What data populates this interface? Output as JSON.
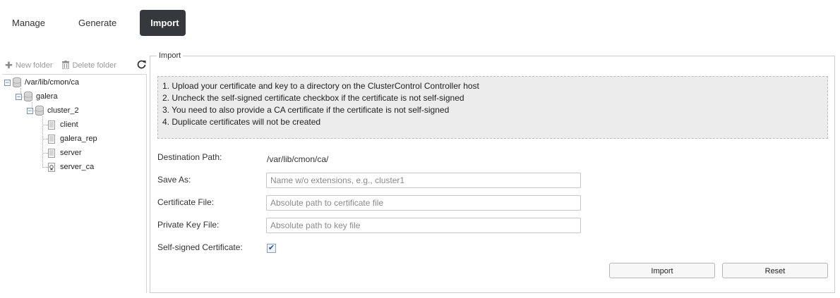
{
  "tabs": [
    {
      "label": "Manage",
      "active": false
    },
    {
      "label": "Generate",
      "active": false
    },
    {
      "label": "Import",
      "active": true
    }
  ],
  "toolbar": {
    "new_folder": "New folder",
    "delete_folder": "Delete folder",
    "refresh_icon": "refresh-icon"
  },
  "tree": {
    "root": "/var/lib/cmon/ca",
    "galera": "galera",
    "cluster": "cluster_2",
    "files": [
      "client",
      "galera_rep",
      "server",
      "server_ca"
    ]
  },
  "import_section": {
    "legend": "Import",
    "instructions": [
      "1. Upload your certificate and key to a directory on the ClusterControl Controller host",
      "2. Uncheck the self-signed certificate checkbox if the certificate is not self-signed",
      "3. You need to also provide a CA certificate if the certificate is not self-signed",
      "4. Duplicate certificates will not be created"
    ],
    "destination_label": "Destination Path:",
    "destination_value": "/var/lib/cmon/ca/",
    "save_as_label": "Save As:",
    "save_as_placeholder": "Name w/o extensions, e.g., cluster1",
    "cert_file_label": "Certificate File:",
    "cert_file_placeholder": "Absolute path to certificate file",
    "key_file_label": "Private Key File:",
    "key_file_placeholder": "Absolute path to key file",
    "self_signed_label": "Self-signed Certificate:",
    "self_signed_checked": true,
    "import_button": "Import",
    "reset_button": "Reset"
  },
  "colors": {
    "active_tab_bg": "#35393d",
    "info_bg": "#ececec"
  }
}
